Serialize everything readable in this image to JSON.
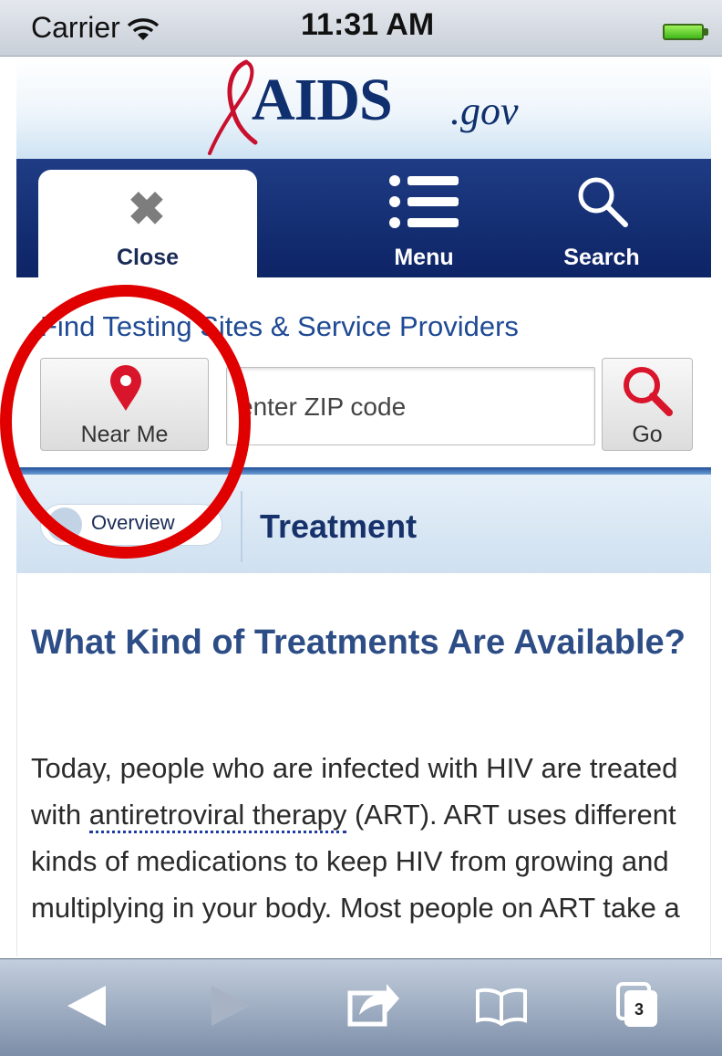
{
  "status_bar": {
    "carrier": "Carrier",
    "time": "11:31 AM"
  },
  "header": {
    "logo_main": "AIDS",
    "logo_suffix": ".gov"
  },
  "nav": {
    "close_label": "Close",
    "menu_label": "Menu",
    "search_label": "Search"
  },
  "find": {
    "title": "Find Testing Sites & Service Providers",
    "near_me_label": "Near Me",
    "zip_placeholder": "enter ZIP code",
    "go_label": "Go"
  },
  "section": {
    "overview_label": "Overview",
    "title": "Treatment"
  },
  "article": {
    "heading": "What Kind of Treatments Are Available?",
    "body_before_link": "Today, people who are infected with HIV are treated with ",
    "link_term": "antiretroviral therapy",
    "body_after_link": " (ART). ART uses different kinds of medications to keep HIV from growing and multiplying in your body. Most people on ART take a"
  },
  "toolbar": {
    "tabs_count": "3"
  },
  "colors": {
    "brand_navy": "#0f2f6e",
    "nav_blue": "#1f3c84",
    "link_blue": "#1f4a94",
    "ribbon_red": "#c8102e",
    "annotation_red": "#e00000"
  },
  "icons": [
    "wifi-icon",
    "battery-icon",
    "ribbon-icon",
    "close-icon",
    "menu-icon",
    "search-icon",
    "map-pin-icon",
    "magnifier-icon",
    "back-icon",
    "forward-icon",
    "share-icon",
    "bookmarks-icon",
    "tabs-icon"
  ]
}
